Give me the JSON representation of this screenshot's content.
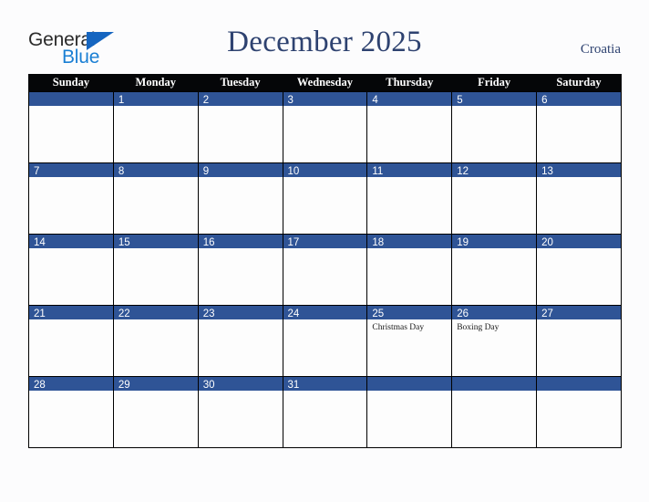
{
  "brand": {
    "word_one": "General",
    "word_two": "Blue",
    "triangle_icon": "triangle-icon",
    "accent_color": "#1a7fd4",
    "triangle_color": "#1565c0"
  },
  "header": {
    "title": "December 2025",
    "region": "Croatia",
    "title_color": "#2e4270"
  },
  "calendar": {
    "day_headers": [
      "Sunday",
      "Monday",
      "Tuesday",
      "Wednesday",
      "Thursday",
      "Friday",
      "Saturday"
    ],
    "header_bg": "#050608",
    "daynum_bg": "#2f5496",
    "cell_bg": "#fdfdfd",
    "weeks": [
      [
        {
          "day": "",
          "events": []
        },
        {
          "day": "1",
          "events": []
        },
        {
          "day": "2",
          "events": []
        },
        {
          "day": "3",
          "events": []
        },
        {
          "day": "4",
          "events": []
        },
        {
          "day": "5",
          "events": []
        },
        {
          "day": "6",
          "events": []
        }
      ],
      [
        {
          "day": "7",
          "events": []
        },
        {
          "day": "8",
          "events": []
        },
        {
          "day": "9",
          "events": []
        },
        {
          "day": "10",
          "events": []
        },
        {
          "day": "11",
          "events": []
        },
        {
          "day": "12",
          "events": []
        },
        {
          "day": "13",
          "events": []
        }
      ],
      [
        {
          "day": "14",
          "events": []
        },
        {
          "day": "15",
          "events": []
        },
        {
          "day": "16",
          "events": []
        },
        {
          "day": "17",
          "events": []
        },
        {
          "day": "18",
          "events": []
        },
        {
          "day": "19",
          "events": []
        },
        {
          "day": "20",
          "events": []
        }
      ],
      [
        {
          "day": "21",
          "events": []
        },
        {
          "day": "22",
          "events": []
        },
        {
          "day": "23",
          "events": []
        },
        {
          "day": "24",
          "events": []
        },
        {
          "day": "25",
          "events": [
            "Christmas Day"
          ]
        },
        {
          "day": "26",
          "events": [
            "Boxing Day"
          ]
        },
        {
          "day": "27",
          "events": []
        }
      ],
      [
        {
          "day": "28",
          "events": []
        },
        {
          "day": "29",
          "events": []
        },
        {
          "day": "30",
          "events": []
        },
        {
          "day": "31",
          "events": []
        },
        {
          "day": "",
          "events": []
        },
        {
          "day": "",
          "events": []
        },
        {
          "day": "",
          "events": []
        }
      ]
    ]
  }
}
